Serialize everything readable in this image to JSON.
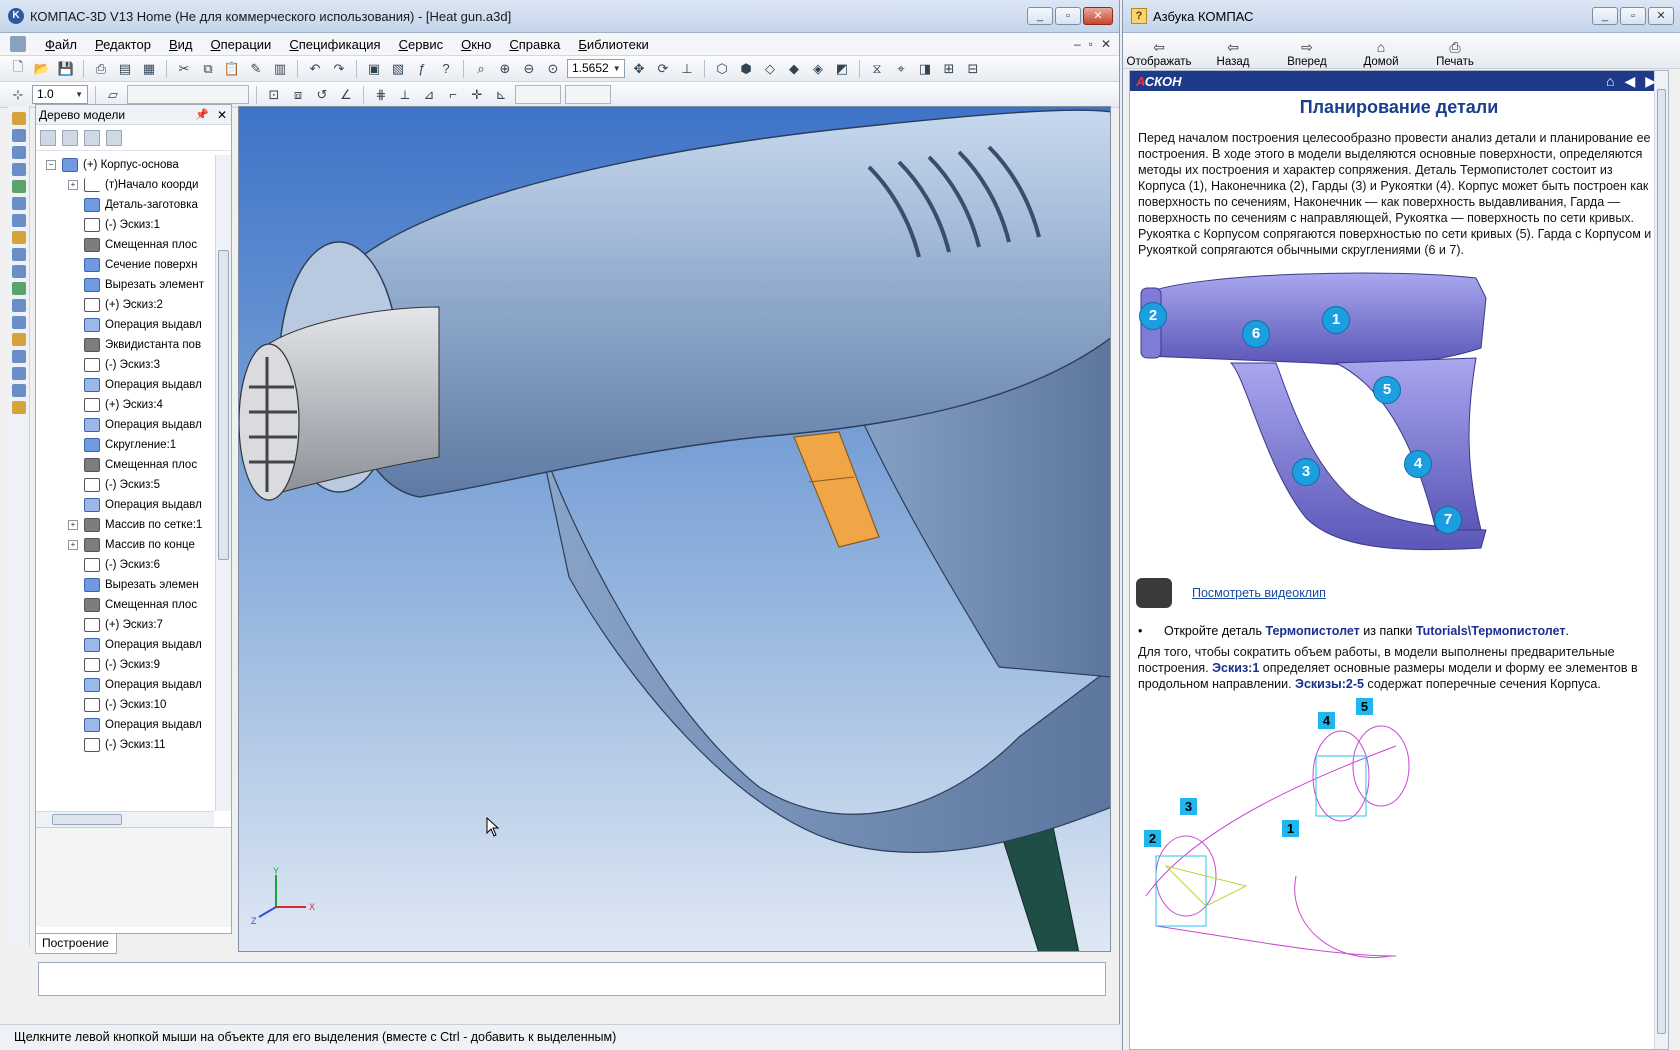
{
  "main": {
    "title": "КОМПАС-3D V13 Home (Не для коммерческого использования) - [Heat gun.a3d]",
    "app_icon_letter": "K",
    "menu": [
      "Файл",
      "Редактор",
      "Вид",
      "Операции",
      "Спецификация",
      "Сервис",
      "Окно",
      "Справка",
      "Библиотеки"
    ],
    "zoom_value": "1.5652",
    "step_value": "1.0",
    "tree": {
      "title": "Дерево модели",
      "tab_label": "Построение",
      "items": [
        {
          "label": "(+) Корпус-основа",
          "icon": "part",
          "exp": "−",
          "indent": 0
        },
        {
          "label": "(т)Начало коорди",
          "icon": "axes",
          "exp": "+",
          "indent": 1
        },
        {
          "label": "Деталь-заготовка",
          "icon": "part",
          "exp": "",
          "indent": 1
        },
        {
          "label": "(-) Эскиз:1",
          "icon": "sketch",
          "exp": "",
          "indent": 1
        },
        {
          "label": "Смещенная плос",
          "icon": "plane",
          "exp": "",
          "indent": 1
        },
        {
          "label": "Сечение поверхн",
          "icon": "part",
          "exp": "",
          "indent": 1
        },
        {
          "label": "Вырезать элемент",
          "icon": "part",
          "exp": "",
          "indent": 1
        },
        {
          "label": "(+) Эскиз:2",
          "icon": "sketch",
          "exp": "",
          "indent": 1
        },
        {
          "label": "Операция выдавл",
          "icon": "op",
          "exp": "",
          "indent": 1
        },
        {
          "label": "Эквидистанта пов",
          "icon": "plane",
          "exp": "",
          "indent": 1
        },
        {
          "label": "(-) Эскиз:3",
          "icon": "sketch",
          "exp": "",
          "indent": 1
        },
        {
          "label": "Операция выдавл",
          "icon": "op",
          "exp": "",
          "indent": 1
        },
        {
          "label": "(+) Эскиз:4",
          "icon": "sketch",
          "exp": "",
          "indent": 1
        },
        {
          "label": "Операция выдавл",
          "icon": "op",
          "exp": "",
          "indent": 1
        },
        {
          "label": "Скругление:1",
          "icon": "part",
          "exp": "",
          "indent": 1
        },
        {
          "label": "Смещенная плос",
          "icon": "plane",
          "exp": "",
          "indent": 1
        },
        {
          "label": "(-) Эскиз:5",
          "icon": "sketch",
          "exp": "",
          "indent": 1
        },
        {
          "label": "Операция выдавл",
          "icon": "op",
          "exp": "",
          "indent": 1
        },
        {
          "label": "Массив по сетке:1",
          "icon": "plane",
          "exp": "+",
          "indent": 1
        },
        {
          "label": "Массив по конце",
          "icon": "plane",
          "exp": "+",
          "indent": 1
        },
        {
          "label": "(-) Эскиз:6",
          "icon": "sketch",
          "exp": "",
          "indent": 1
        },
        {
          "label": "Вырезать элемен",
          "icon": "part",
          "exp": "",
          "indent": 1
        },
        {
          "label": "Смещенная плос",
          "icon": "plane",
          "exp": "",
          "indent": 1
        },
        {
          "label": "(+) Эскиз:7",
          "icon": "sketch",
          "exp": "",
          "indent": 1
        },
        {
          "label": "Операция выдавл",
          "icon": "op",
          "exp": "",
          "indent": 1
        },
        {
          "label": "(-) Эскиз:9",
          "icon": "sketch",
          "exp": "",
          "indent": 1
        },
        {
          "label": "Операция выдавл",
          "icon": "op",
          "exp": "",
          "indent": 1
        },
        {
          "label": "(-) Эскиз:10",
          "icon": "sketch",
          "exp": "",
          "indent": 1
        },
        {
          "label": "Операция выдавл",
          "icon": "op",
          "exp": "",
          "indent": 1
        },
        {
          "label": "(-) Эскиз:11",
          "icon": "sketch",
          "exp": "",
          "indent": 1
        }
      ]
    },
    "axes_labels": {
      "x": "X",
      "y": "Y",
      "z": "Z"
    },
    "status_text": "Щелкните левой кнопкой мыши на объекте для его выделения (вместе с Ctrl - добавить к выделенным)"
  },
  "help": {
    "title": "Азбука КОМПАС",
    "toolbar": [
      {
        "label": "Отображать",
        "icon": "display-icon",
        "glyph": "⇦"
      },
      {
        "label": "Назад",
        "icon": "back-icon",
        "glyph": "⇦"
      },
      {
        "label": "Вперед",
        "icon": "forward-icon",
        "glyph": "⇨"
      },
      {
        "label": "Домой",
        "icon": "home-icon",
        "glyph": "⌂"
      },
      {
        "label": "Печать",
        "icon": "print-icon",
        "glyph": "⎙"
      }
    ],
    "logo_text": "СКОН",
    "logo_prefix": "А",
    "heading": "Планирование детали",
    "intro": "Перед началом построения целесообразно провести анализ детали и планирование ее построения. В ходе этого в модели выделяются основные поверхности, определяются методы их построения и характер сопряжения. Деталь Термопистолет состоит из Корпуса (1), Наконечника (2), Гарды (3) и Рукоятки (4). Корпус может быть построен как поверхность по сечениям, Наконечник — как поверхность выдавливания, Гарда — поверхность по сечениям с направляющей, Рукоятка — поверхность по сети кривых. Рукоятка с Корпусом сопрягаются поверхностью по сети кривых (5). Гарда с Корпусом и Рукояткой сопрягаются обычными скруглениями (6 и 7).",
    "fig1_badges": [
      "1",
      "2",
      "3",
      "4",
      "5",
      "6",
      "7"
    ],
    "video_link": "Посмотреть видеоклип",
    "bullet_pre": "Откройте деталь ",
    "bullet_kw1": "Термопистолет",
    "bullet_mid": " из папки ",
    "bullet_kw2": "Tutorials\\Термопистолет",
    "bullet_end": ".",
    "p2_a": "Для того, чтобы сократить объем работы, в модели выполнены предварительные построения. ",
    "p2_kw1": "Эскиз:1",
    "p2_b": " определяет основные размеры модели и форму ее элементов в продольном направлении. ",
    "p2_kw2": "Эскизы:2-5",
    "p2_c": " содержат поперечные сечения Корпуса.",
    "fig2_labels": [
      "1",
      "2",
      "3",
      "4",
      "5"
    ]
  },
  "colors": {
    "viewport_top": "#3e73c7",
    "model_body": "#8fa8cb",
    "trigger": "#f0a646",
    "help_part": "#7a78cf",
    "badge": "#1b9fe0",
    "sketch_lines": "#c94ad1"
  }
}
